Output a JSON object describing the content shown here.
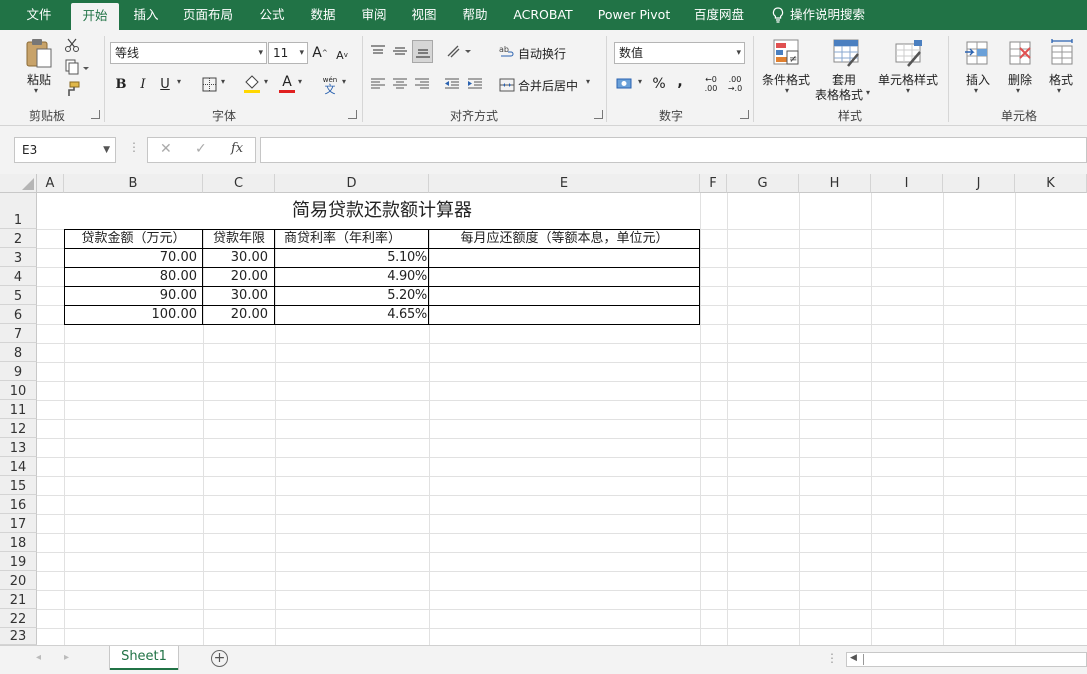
{
  "tabs": [
    "文件",
    "开始",
    "插入",
    "页面布局",
    "公式",
    "数据",
    "审阅",
    "视图",
    "帮助",
    "ACROBAT",
    "Power Pivot",
    "百度网盘",
    "操作说明搜索"
  ],
  "ribbon": {
    "clipboard": {
      "paste": "粘贴",
      "label": "剪贴板"
    },
    "font": {
      "name": "等线",
      "size": "11",
      "bold": "B",
      "italic": "I",
      "underline": "U",
      "grow": "A",
      "shrink": "A",
      "color_letter": "A",
      "phonetic_top": "wén",
      "phonetic_bottom": "文",
      "label": "字体"
    },
    "align": {
      "wrap": "自动换行",
      "merge": "合并后居中",
      "label": "对齐方式"
    },
    "number": {
      "format": "数值",
      "percent": "%",
      "comma": ",",
      "inc_top": "←0",
      "inc_bottom": ".00",
      "dec_top": ".00",
      "dec_bottom": "→.0",
      "label": "数字"
    },
    "styles": {
      "cond": "条件格式",
      "table_top": "套用",
      "table_bottom": "表格格式",
      "cell_style": "单元格样式",
      "label": "样式"
    },
    "cells": {
      "insert": "插入",
      "delete": "删除",
      "format": "格式",
      "label": "单元格"
    }
  },
  "formula_bar": {
    "cell_ref": "E3",
    "cancel": "✕",
    "enter": "✓",
    "fx": "fx",
    "formula": ""
  },
  "grid": {
    "columns": [
      "A",
      "B",
      "C",
      "D",
      "E",
      "F",
      "G",
      "H",
      "I",
      "J",
      "K"
    ],
    "rows": [
      "1",
      "2",
      "3",
      "4",
      "5",
      "6",
      "7",
      "8",
      "9",
      "10",
      "11",
      "12",
      "13",
      "14",
      "15",
      "16",
      "17",
      "18",
      "19",
      "20",
      "21",
      "22",
      "23"
    ],
    "title": "简易贷款还款额计算器",
    "headers": [
      "贷款金额（万元）",
      "贷款年限",
      "商贷利率（年利率）",
      "每月应还额度（等额本息，单位元）"
    ],
    "data": [
      [
        "70.00",
        "30.00",
        "5.10%",
        ""
      ],
      [
        "80.00",
        "20.00",
        "4.90%",
        ""
      ],
      [
        "90.00",
        "30.00",
        "5.20%",
        ""
      ],
      [
        "100.00",
        "20.00",
        "4.65%",
        ""
      ]
    ]
  },
  "sheet": {
    "name": "Sheet1",
    "add": "+"
  },
  "colors": {
    "accent": "#217346",
    "ribbon_bg": "#f3f3f3"
  }
}
